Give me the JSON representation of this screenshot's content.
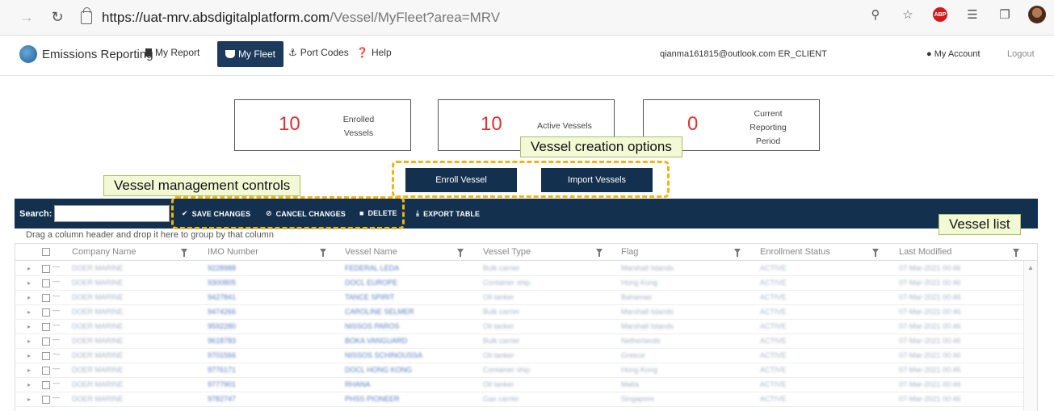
{
  "browser": {
    "url_host": "https://uat-mrv.absdigitalplatform.com",
    "url_rest": "/Vessel/MyFleet?area=MRV",
    "abp_label": "ABP"
  },
  "nav": {
    "brand": "Emissions Reporting",
    "my_report": "My Report",
    "my_fleet": "My Fleet",
    "port_codes": "Port Codes",
    "help": "Help",
    "user": "qianma161815@outlook.com ER_CLIENT",
    "my_account": "My Account",
    "logout": "Logout"
  },
  "stats": {
    "enrolled": {
      "value": "10",
      "label": "Enrolled Vessels"
    },
    "active": {
      "value": "10",
      "label": "Active Vessels"
    },
    "current": {
      "value": "0",
      "label": "Current Reporting Period"
    }
  },
  "actions": {
    "enroll": "Enroll Vessel",
    "import": "Import Vessels"
  },
  "callouts": {
    "creation": "Vessel creation options",
    "management": "Vessel management controls",
    "list": "Vessel list"
  },
  "toolbar": {
    "search_label": "Search:",
    "save": "SAVE CHANGES",
    "cancel": "CANCEL CHANGES",
    "delete": "DELETE",
    "export": "EXPORT TABLE"
  },
  "grid": {
    "group_hint": "Drag a column header and drop it here to group by that column",
    "columns": [
      "Company Name",
      "IMO Number",
      "Vessel Name",
      "Vessel Type",
      "Flag",
      "Enrollment Status",
      "Last Modified"
    ],
    "rows": [
      [
        "DOER MARINE",
        "9228988",
        "FEDERAL LEDA",
        "Bulk carrier",
        "Marshall Islands",
        "ACTIVE",
        "07-Mar-2021 00:46"
      ],
      [
        "DOER MARINE",
        "9300805",
        "DOCL EUROPE",
        "Container ship",
        "Hong Kong",
        "ACTIVE",
        "07-Mar-2021 00:46"
      ],
      [
        "DOER MARINE",
        "9427841",
        "TANCE SPIRIT",
        "Oil tanker",
        "Bahamas",
        "ACTIVE",
        "07-Mar-2021 00:46"
      ],
      [
        "DOER MARINE",
        "9474266",
        "CAROLINE SELMER",
        "Bulk carrier",
        "Marshall Islands",
        "ACTIVE",
        "07-Mar-2021 00:46"
      ],
      [
        "DOER MARINE",
        "9592280",
        "NISSOS PAROS",
        "Oil tanker",
        "Marshall Islands",
        "ACTIVE",
        "07-Mar-2021 00:46"
      ],
      [
        "DOER MARINE",
        "9618783",
        "BOKA VANGUARD",
        "Bulk carrier",
        "Netherlands",
        "ACTIVE",
        "07-Mar-2021 00:46"
      ],
      [
        "DOER MARINE",
        "9701566",
        "NISSOS SCHINOUSSA",
        "Oil tanker",
        "Greece",
        "ACTIVE",
        "07-Mar-2021 00:46"
      ],
      [
        "DOER MARINE",
        "9776171",
        "DOCL HONG KONG",
        "Container ship",
        "Hong Kong",
        "ACTIVE",
        "07-Mar-2021 00:46"
      ],
      [
        "DOER MARINE",
        "9777901",
        "RHANA",
        "Oil tanker",
        "Malta",
        "ACTIVE",
        "07-Mar-2021 00:46"
      ],
      [
        "DOER MARINE",
        "9782747",
        "PHSS PIONEER",
        "Gas carrier",
        "Singapore",
        "ACTIVE",
        "07-Mar-2021 00:46"
      ]
    ]
  }
}
